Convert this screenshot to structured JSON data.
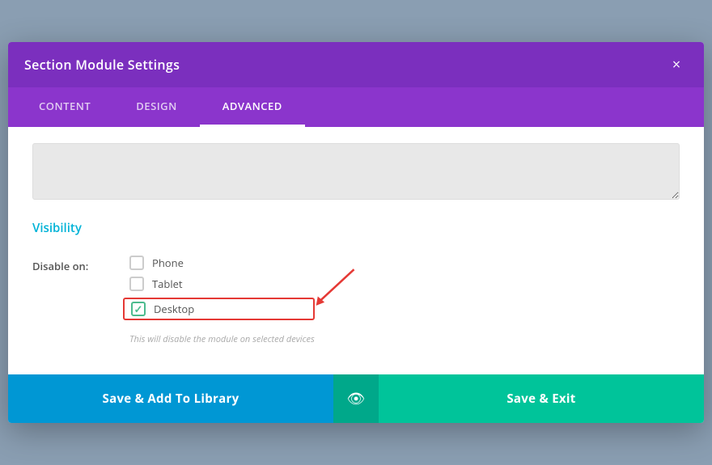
{
  "modal": {
    "title": "Section Module Settings",
    "close_label": "×"
  },
  "tabs": [
    {
      "id": "content",
      "label": "Content",
      "active": false
    },
    {
      "id": "design",
      "label": "Design",
      "active": false
    },
    {
      "id": "advanced",
      "label": "Advanced",
      "active": true
    }
  ],
  "advanced": {
    "visibility_section_label": "Visibility",
    "disable_on_label": "Disable on:",
    "checkboxes": [
      {
        "id": "phone",
        "label": "Phone",
        "checked": false
      },
      {
        "id": "tablet",
        "label": "Tablet",
        "checked": false
      },
      {
        "id": "desktop",
        "label": "Desktop",
        "checked": true,
        "highlighted": true
      }
    ],
    "hint_text": "This will disable the module on selected devices"
  },
  "footer": {
    "save_library_label": "Save & Add To Library",
    "save_exit_label": "Save & Exit",
    "eye_icon": "👁"
  },
  "colors": {
    "tab_bg": "#8b35cc",
    "tab_active_border": "#ffffff",
    "header_bg": "#7b2fbe",
    "visibility_title": "#00b3d7",
    "save_library_bg": "#0097d4",
    "save_exit_bg": "#00c49a",
    "middle_btn_bg": "#00a88a"
  }
}
